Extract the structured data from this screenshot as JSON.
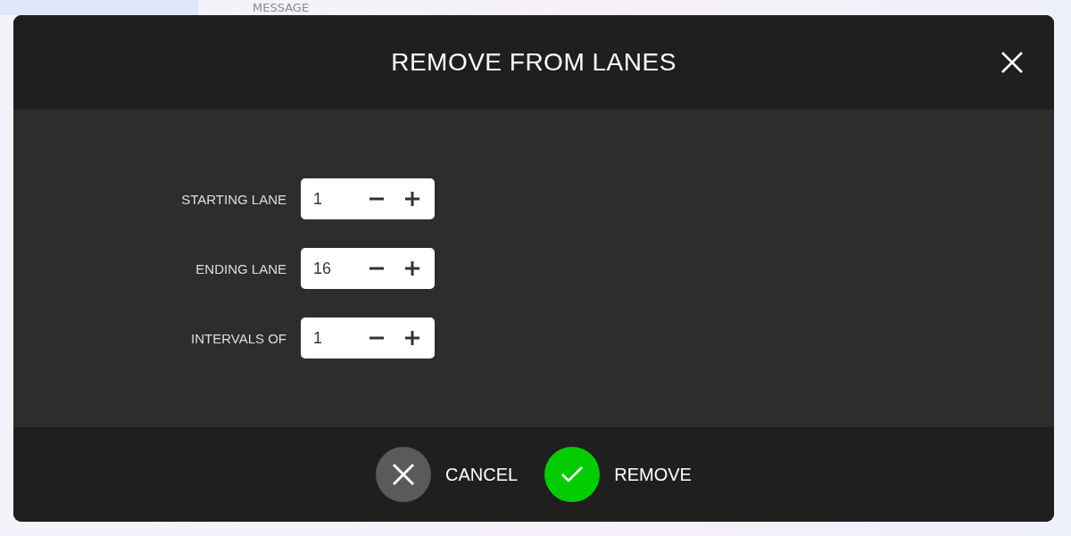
{
  "background": {
    "heading": "MESSAGE"
  },
  "dialog": {
    "title": "REMOVE FROM LANES",
    "fields": [
      {
        "label": "STARTING LANE",
        "value": "1"
      },
      {
        "label": "ENDING LANE",
        "value": "16"
      },
      {
        "label": "INTERVALS OF",
        "value": "1"
      }
    ],
    "buttons": [
      {
        "kind": "cancel",
        "label": "CANCEL"
      },
      {
        "kind": "confirm",
        "label": "REMOVE"
      }
    ]
  }
}
